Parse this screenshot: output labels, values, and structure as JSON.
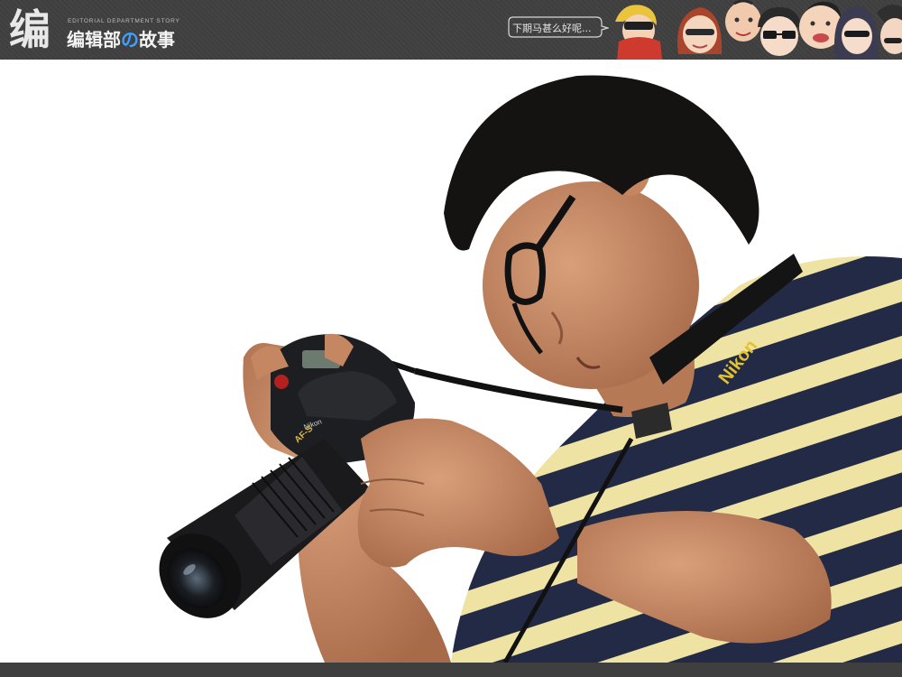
{
  "header": {
    "logo_glyph": "编",
    "subtitle": "EDITORIAL DEPARTMENT STORY",
    "title_part1": "编辑部",
    "title_accent": "の",
    "title_part2": "故事",
    "speech_text": "下期马甚么好呢...",
    "accent_color": "#3fa0ff"
  },
  "photo": {
    "strap_brand": "Nikon",
    "camera_brand": "Nikon"
  }
}
